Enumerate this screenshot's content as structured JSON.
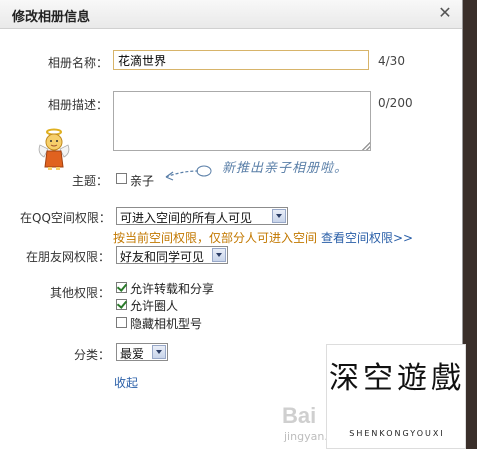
{
  "dialog": {
    "title": "修改相册信息",
    "close_icon": "close-icon"
  },
  "form": {
    "name_label": "相册名称：",
    "name_value": "花滴世界",
    "name_counter": "4/30",
    "desc_label": "相册描述：",
    "desc_value": "",
    "desc_counter": "0/200",
    "theme_label": "主题：",
    "theme_option": "亲子",
    "theme_checked": false,
    "theme_hint": "新推出亲子相册啦。",
    "qzone_label": "在QQ空间权限：",
    "qzone_value": "可进入空间的所有人可见",
    "qzone_note": "按当前空间权限，仅部分人可进入空间",
    "qzone_link": "查看空间权限>>",
    "friend_label": "在朋友网权限：",
    "friend_value": "好友和同学可见",
    "other_label": "其他权限：",
    "other_options": [
      {
        "label": "允许转载和分享",
        "checked": true
      },
      {
        "label": "允许圈人",
        "checked": true
      },
      {
        "label": "隐藏相机型号",
        "checked": false
      }
    ],
    "category_label": "分类：",
    "category_value": "最爱",
    "collapse_link": "收起"
  },
  "watermark": {
    "chars": "深空遊戲",
    "sub": "SHENKONGYOUXI"
  },
  "baidu_watermark": {
    "text": "Bai",
    "url": "jingyan.baidu.com"
  },
  "colors": {
    "accent_link": "#2a5fa8",
    "note_orange": "#c27800",
    "hint_blue": "#5a7fa8"
  }
}
